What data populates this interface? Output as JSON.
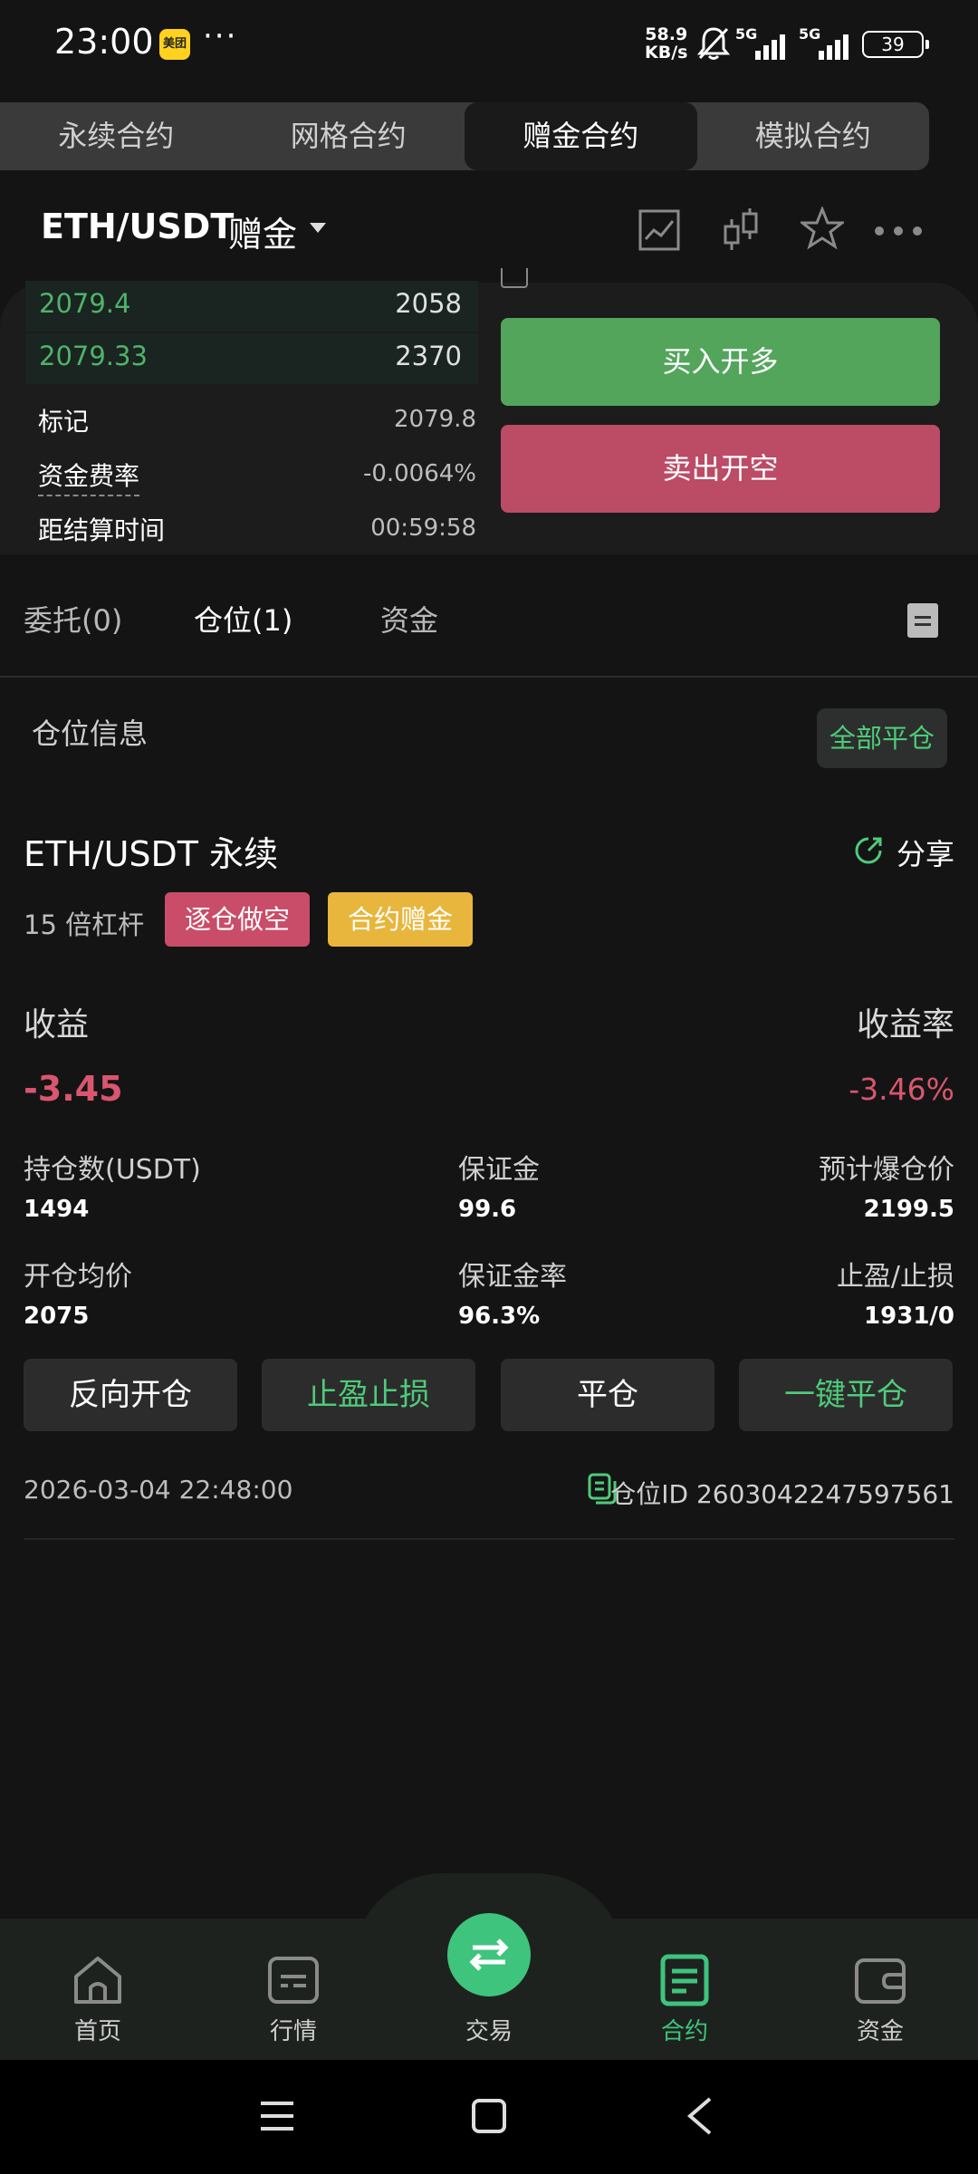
{
  "status_bar": {
    "time": "23:00",
    "app_badge": "美团",
    "more": "···",
    "net_speed_value": "58.9",
    "net_speed_unit": "KB/s",
    "signal_1": "5G",
    "signal_2": "5G",
    "battery": "39"
  },
  "top_tabs": [
    "永续合约",
    "网格合约",
    "赠金合约",
    "模拟合约"
  ],
  "top_tab_active": 2,
  "header": {
    "pair": "ETH/USDT",
    "mode": "赠金"
  },
  "order_book": {
    "asks": [
      {
        "price": "2079.4",
        "qty": "2058"
      },
      {
        "price": "2079.33",
        "qty": "2370"
      }
    ],
    "mark_label": "标记",
    "mark_value": "2079.8",
    "funding_label": "资金费率",
    "funding_value": "-0.0064%",
    "settle_label": "距结算时间",
    "settle_value": "00:59:58"
  },
  "actions": {
    "buy_long": "买入开多",
    "sell_short": "卖出开空"
  },
  "position_tabs": {
    "orders": "委托(0)",
    "positions": "仓位(1)",
    "funds": "资金"
  },
  "position": {
    "section_title": "仓位信息",
    "close_all": "全部平仓",
    "contract": "ETH/USDT 永续",
    "share": "分享",
    "leverage": "15 倍杠杆",
    "tag_side": "逐仓做空",
    "tag_bonus": "合约赠金",
    "pnl_label": "收益",
    "pnl_rate_label": "收益率",
    "pnl_value": "-3.45",
    "pnl_rate_value": "-3.46%",
    "size_label": "持仓数(USDT)",
    "size_value": "1494",
    "margin_label": "保证金",
    "margin_value": "99.6",
    "liq_label": "预计爆仓价",
    "liq_value": "2199.5",
    "entry_label": "开仓均价",
    "entry_value": "2075",
    "margin_rate_label": "保证金率",
    "margin_rate_value": "96.3%",
    "tpsl_label": "止盈/止损",
    "tpsl_value": "1931/0",
    "btn_reverse": "反向开仓",
    "btn_tpsl": "止盈止损",
    "btn_close": "平仓",
    "btn_oneclick": "一键平仓",
    "open_time": "2026-03-04 22:48:00",
    "position_id": "仓位ID 2603042247597561"
  },
  "bottom_nav": [
    {
      "label": "首页",
      "icon": "home-icon"
    },
    {
      "label": "行情",
      "icon": "market-icon"
    },
    {
      "label": "交易",
      "icon": "swap-icon"
    },
    {
      "label": "合约",
      "icon": "contract-icon"
    },
    {
      "label": "资金",
      "icon": "wallet-icon"
    }
  ],
  "bottom_nav_active": 3,
  "colors": {
    "green": "#4fb36a",
    "red": "#d9566f",
    "buy": "#53a55c",
    "sell": "#bc4b66",
    "bonus": "#e8b63c",
    "background": "#141414"
  }
}
